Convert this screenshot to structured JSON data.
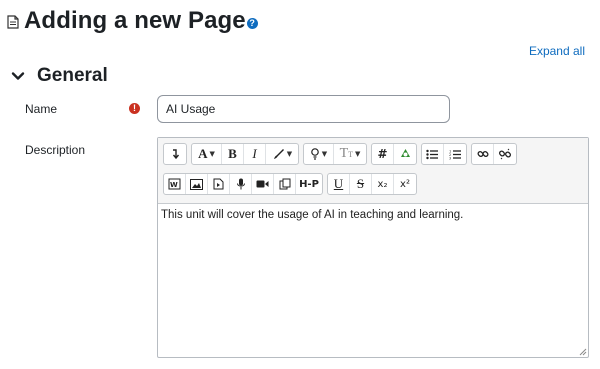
{
  "page": {
    "title": "Adding a new Page",
    "help_icon": "?",
    "expand_all": "Expand all"
  },
  "section": {
    "title": "General"
  },
  "form": {
    "name": {
      "label": "Name",
      "value": "AI Usage",
      "required_icon": "!"
    },
    "description": {
      "label": "Description",
      "content": "This unit will cover the usage of AI in teaching and learning."
    }
  },
  "toolbar": {
    "row1": [
      [
        "collapse-icon"
      ],
      [
        "font-style-icon",
        "bold-icon",
        "italic-icon",
        "text-color-icon"
      ],
      [
        "highlight-icon",
        "font-size-icon"
      ],
      [
        "equation-icon",
        "recycle-icon"
      ],
      [
        "bullet-list-icon",
        "numbered-list-icon"
      ],
      [
        "link-icon",
        "unlink-icon"
      ]
    ],
    "row2": [
      [
        "word-import-icon",
        "image-icon",
        "media-icon",
        "record-audio-icon",
        "record-video-icon",
        "manage-files-icon",
        "h5p-icon"
      ],
      [
        "underline-icon",
        "strikethrough-icon",
        "subscript-icon",
        "superscript-icon"
      ]
    ],
    "labels": {
      "font_style": "A",
      "bold": "B",
      "italic": "I",
      "equation": "#",
      "h5p": "H-P",
      "underline": "U",
      "strikethrough": "S",
      "subscript": "x₂",
      "superscript": "x²",
      "font_size": "T"
    }
  },
  "colors": {
    "link": "#0f6cbf",
    "required": "#ca3120",
    "border": "#8f959e"
  }
}
